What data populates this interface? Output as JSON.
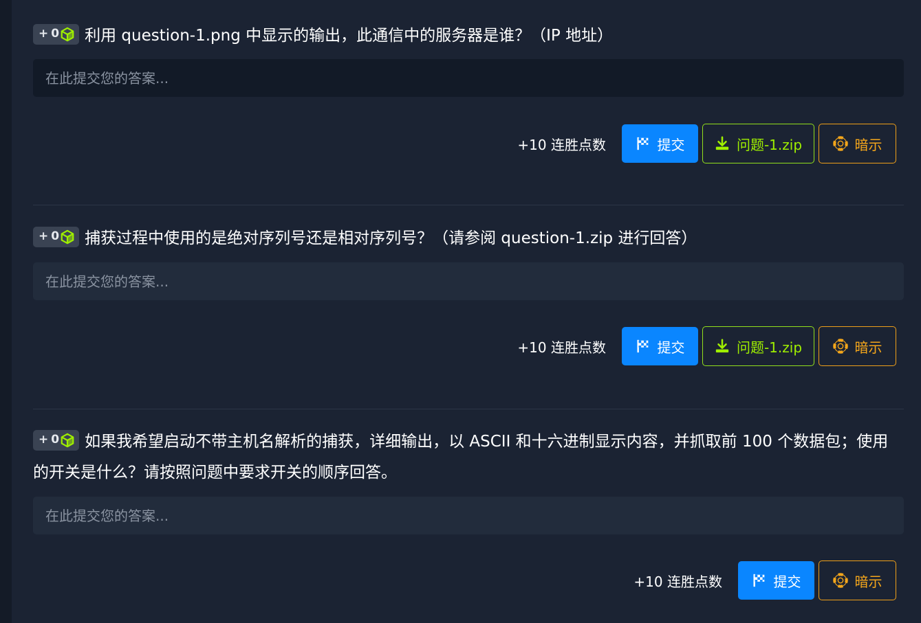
{
  "badge": {
    "plus": "+",
    "points": "0"
  },
  "questions": [
    {
      "title": "利用 question-1.png 中显示的输出，此通信中的服务器是谁？（IP 地址）",
      "placeholder": "在此提交您的答案...",
      "streak": "+10 连胜点数",
      "submit": "提交",
      "download": "问题-1.zip",
      "hint": "暗示"
    },
    {
      "title": "捕获过程中使用的是绝对序列号还是相对序列号？（请参阅 question-1.zip 进行回答）",
      "placeholder": "在此提交您的答案...",
      "streak": "+10 连胜点数",
      "submit": "提交",
      "download": "问题-1.zip",
      "hint": "暗示"
    },
    {
      "title": "如果我希望启动不带主机名解析的捕获，详细输出，以 ASCII 和十六进制显示内容，并抓取前 100 个数据包；使用的开关是什么？请按照问题中要求开关的顺序回答。",
      "placeholder": "在此提交您的答案...",
      "streak": "+10 连胜点数",
      "submit": "提交",
      "hint": "暗示"
    }
  ],
  "colors": {
    "accent_blue": "#0a86ff",
    "accent_green": "#9fef00",
    "accent_orange": "#f4a61b",
    "background": "#1b2333"
  },
  "icons": {
    "badge": "cube-icon",
    "submit": "flag-icon",
    "download": "download-icon",
    "hint": "lifebuoy-icon"
  }
}
